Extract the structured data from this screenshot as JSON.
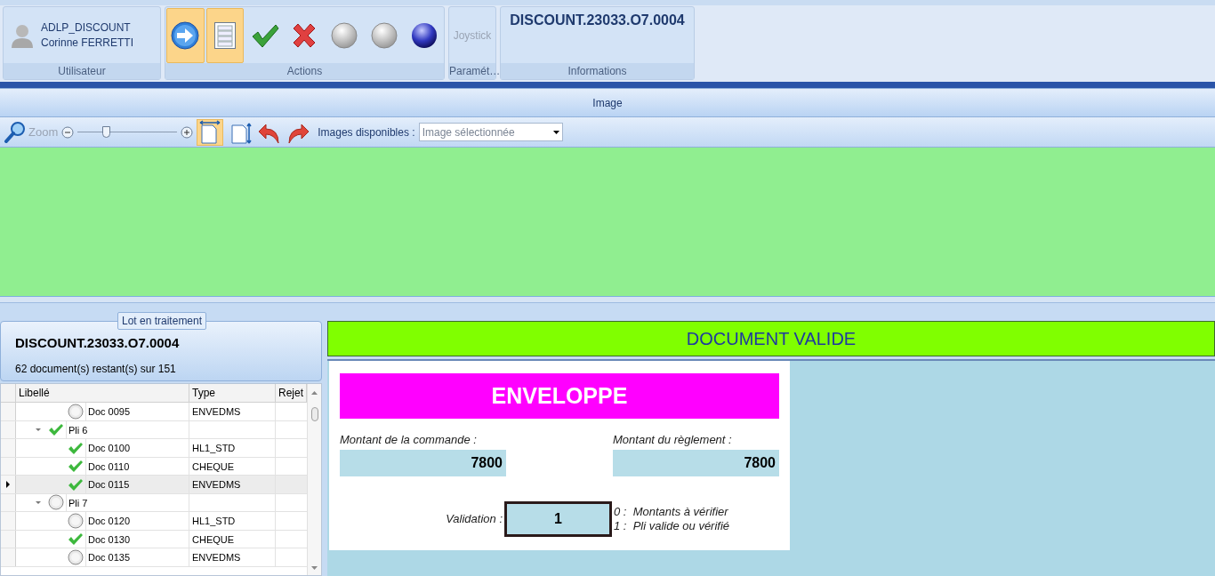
{
  "ribbon": {
    "groups": [
      {
        "kind": "user",
        "caption": "Utilisateur",
        "login": "ADLP_DISCOUNT",
        "name": "Corinne FERRETTI"
      },
      {
        "kind": "actions",
        "caption": "Actions",
        "buttons": [
          {
            "kind": "arrow",
            "highlighted": true
          },
          {
            "kind": "clipboard",
            "highlighted": true
          },
          {
            "kind": "check",
            "highlighted": false
          },
          {
            "kind": "cross",
            "highlighted": false
          },
          {
            "kind": "grey-ball",
            "highlighted": false
          },
          {
            "kind": "grey-ball",
            "highlighted": false
          },
          {
            "kind": "blue-ball",
            "highlighted": false
          }
        ]
      },
      {
        "kind": "settings",
        "caption": "Paramét…",
        "button": {
          "label": "Joystick",
          "disabled": true
        }
      },
      {
        "kind": "info",
        "caption": "Informations",
        "value": "DISCOUNT.23033.O7.0004"
      }
    ]
  },
  "image_panel": {
    "title": "Image",
    "toolbar": {
      "zoom_label": "Zoom",
      "zoom": {
        "level": 0.28
      },
      "fit_width": {
        "highlighted": true
      },
      "fit_height": {
        "highlighted": false
      },
      "images_label": "Images disponibles :",
      "images_select": "Image sélectionnée"
    }
  },
  "batch": {
    "legend": "Lot en traitement",
    "name": "DISCOUNT.23033.O7.0004",
    "remaining": "62 document(s) restant(s) sur 151"
  },
  "grid": {
    "columns": [
      "Libellé",
      "Type",
      "Rejet"
    ],
    "rows": [
      {
        "children": [
          {
            "label": "Doc 0095",
            "type": "ENVEDMS",
            "validated": false,
            "selected": false
          }
        ]
      },
      {
        "label": "Pli 6",
        "validated": true,
        "expanded": true,
        "selected": false,
        "children": [
          {
            "label": "Doc 0100",
            "type": "HL1_STD",
            "validated": true,
            "selected": false
          },
          {
            "label": "Doc 0110",
            "type": "CHEQUE",
            "validated": true,
            "selected": false
          },
          {
            "label": "Doc 0115",
            "type": "ENVEDMS",
            "validated": true,
            "selected": true
          }
        ]
      },
      {
        "label": "Pli 7",
        "validated": false,
        "expanded": true,
        "selected": false,
        "children": [
          {
            "label": "Doc 0120",
            "type": "HL1_STD",
            "validated": false,
            "selected": false
          },
          {
            "label": "Doc 0130",
            "type": "CHEQUE",
            "validated": true,
            "selected": false
          },
          {
            "label": "Doc 0135",
            "type": "ENVEDMS",
            "validated": false,
            "selected": false
          }
        ]
      }
    ]
  },
  "status_banner": {
    "text": "DOCUMENT VALIDE",
    "color": "#80ff00"
  },
  "form": {
    "title": "ENVELOPPE",
    "order_label": "Montant de la commande :",
    "order_value": "7800",
    "payment_label": "Montant du règlement :",
    "payment_value": "7800",
    "validation_label": "Validation :",
    "validation_value": "1",
    "legend": [
      "0 :  Montants à vérifier",
      "1 :  Pli valide ou vérifié"
    ]
  }
}
